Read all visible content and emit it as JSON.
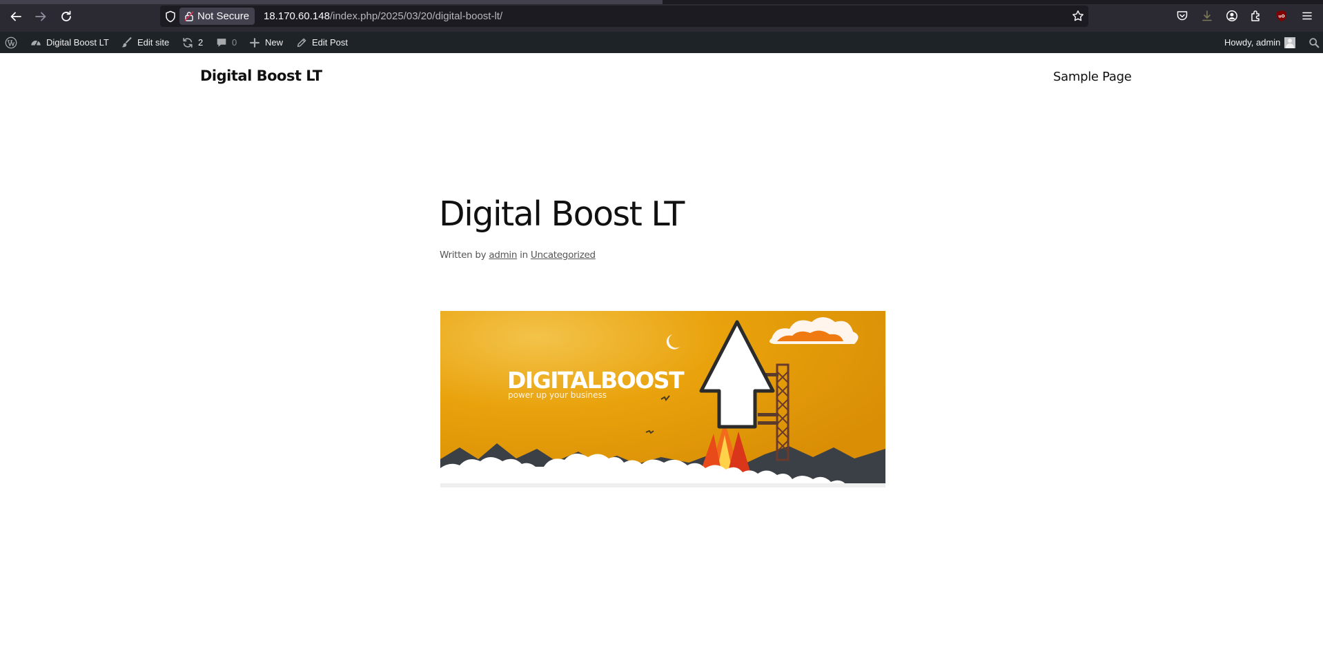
{
  "browser": {
    "security_label": "Not Secure",
    "url_host": "18.170.60.148",
    "url_path": "/index.php/2025/03/20/digital-boost-lt/",
    "icons": [
      "back-icon",
      "forward-icon",
      "reload-icon",
      "shield-icon",
      "lock-icon",
      "bookmark-star-icon",
      "pocket-icon",
      "download-icon",
      "account-icon",
      "extensions-icon",
      "ublock-icon",
      "menu-icon"
    ]
  },
  "adminbar": {
    "site_name": "Digital Boost LT",
    "edit_site": "Edit site",
    "updates_count": "2",
    "comments_count": "0",
    "new_label": "New",
    "edit_post": "Edit Post",
    "howdy": "Howdy, admin"
  },
  "site": {
    "title": "Digital Boost LT",
    "nav": [
      "Sample Page"
    ]
  },
  "post": {
    "title": "Digital Boost LT",
    "meta": {
      "written_by": "Written by",
      "author": "admin",
      "in": "in",
      "category": "Uncategorized"
    },
    "image": {
      "brand_text": "DIGITALBOOST",
      "tagline": "power up your business"
    }
  },
  "colors": {
    "browser_bg": "#2b2a33",
    "urlbar_bg": "#1c1b22",
    "adminbar_bg": "#1d2327",
    "banner_yellow": "#e9a20c"
  }
}
